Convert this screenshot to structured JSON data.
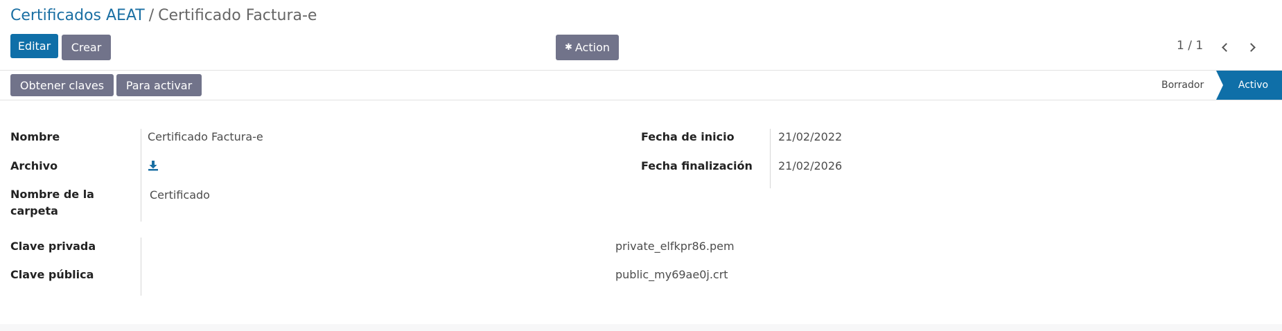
{
  "breadcrumb": {
    "parent": "Certificados AEAT",
    "separator": "/",
    "current": "Certificado Factura-e"
  },
  "control": {
    "edit_label": "Editar",
    "create_label": "Crear",
    "action_label": "Action",
    "action_icon": "gear-icon",
    "pager": "1 / 1"
  },
  "statusbar": {
    "buttons": [
      "Obtener claves",
      "Para activar"
    ],
    "stages": [
      "Borrador",
      "Activo"
    ],
    "active_stage": "Activo"
  },
  "form": {
    "left": [
      {
        "label": "Nombre",
        "value": "Certificado Factura-e"
      },
      {
        "label": "Archivo",
        "value_icon": "download-icon"
      },
      {
        "label_line1": "Nombre de la",
        "label_line2": "carpeta",
        "value": "Certificado"
      }
    ],
    "right": [
      {
        "label": "Fecha de inicio",
        "value": "21/02/2022"
      },
      {
        "label": "Fecha finalización",
        "value": "21/02/2026"
      }
    ],
    "keys": [
      {
        "label": "Clave privada",
        "value": "private_elfkpr86.pem"
      },
      {
        "label": "Clave pública",
        "value": "public_my69ae0j.crt"
      }
    ]
  },
  "colors": {
    "primary": "#0f6fa8",
    "secondary": "#71738a",
    "link": "#1a6fa3"
  }
}
